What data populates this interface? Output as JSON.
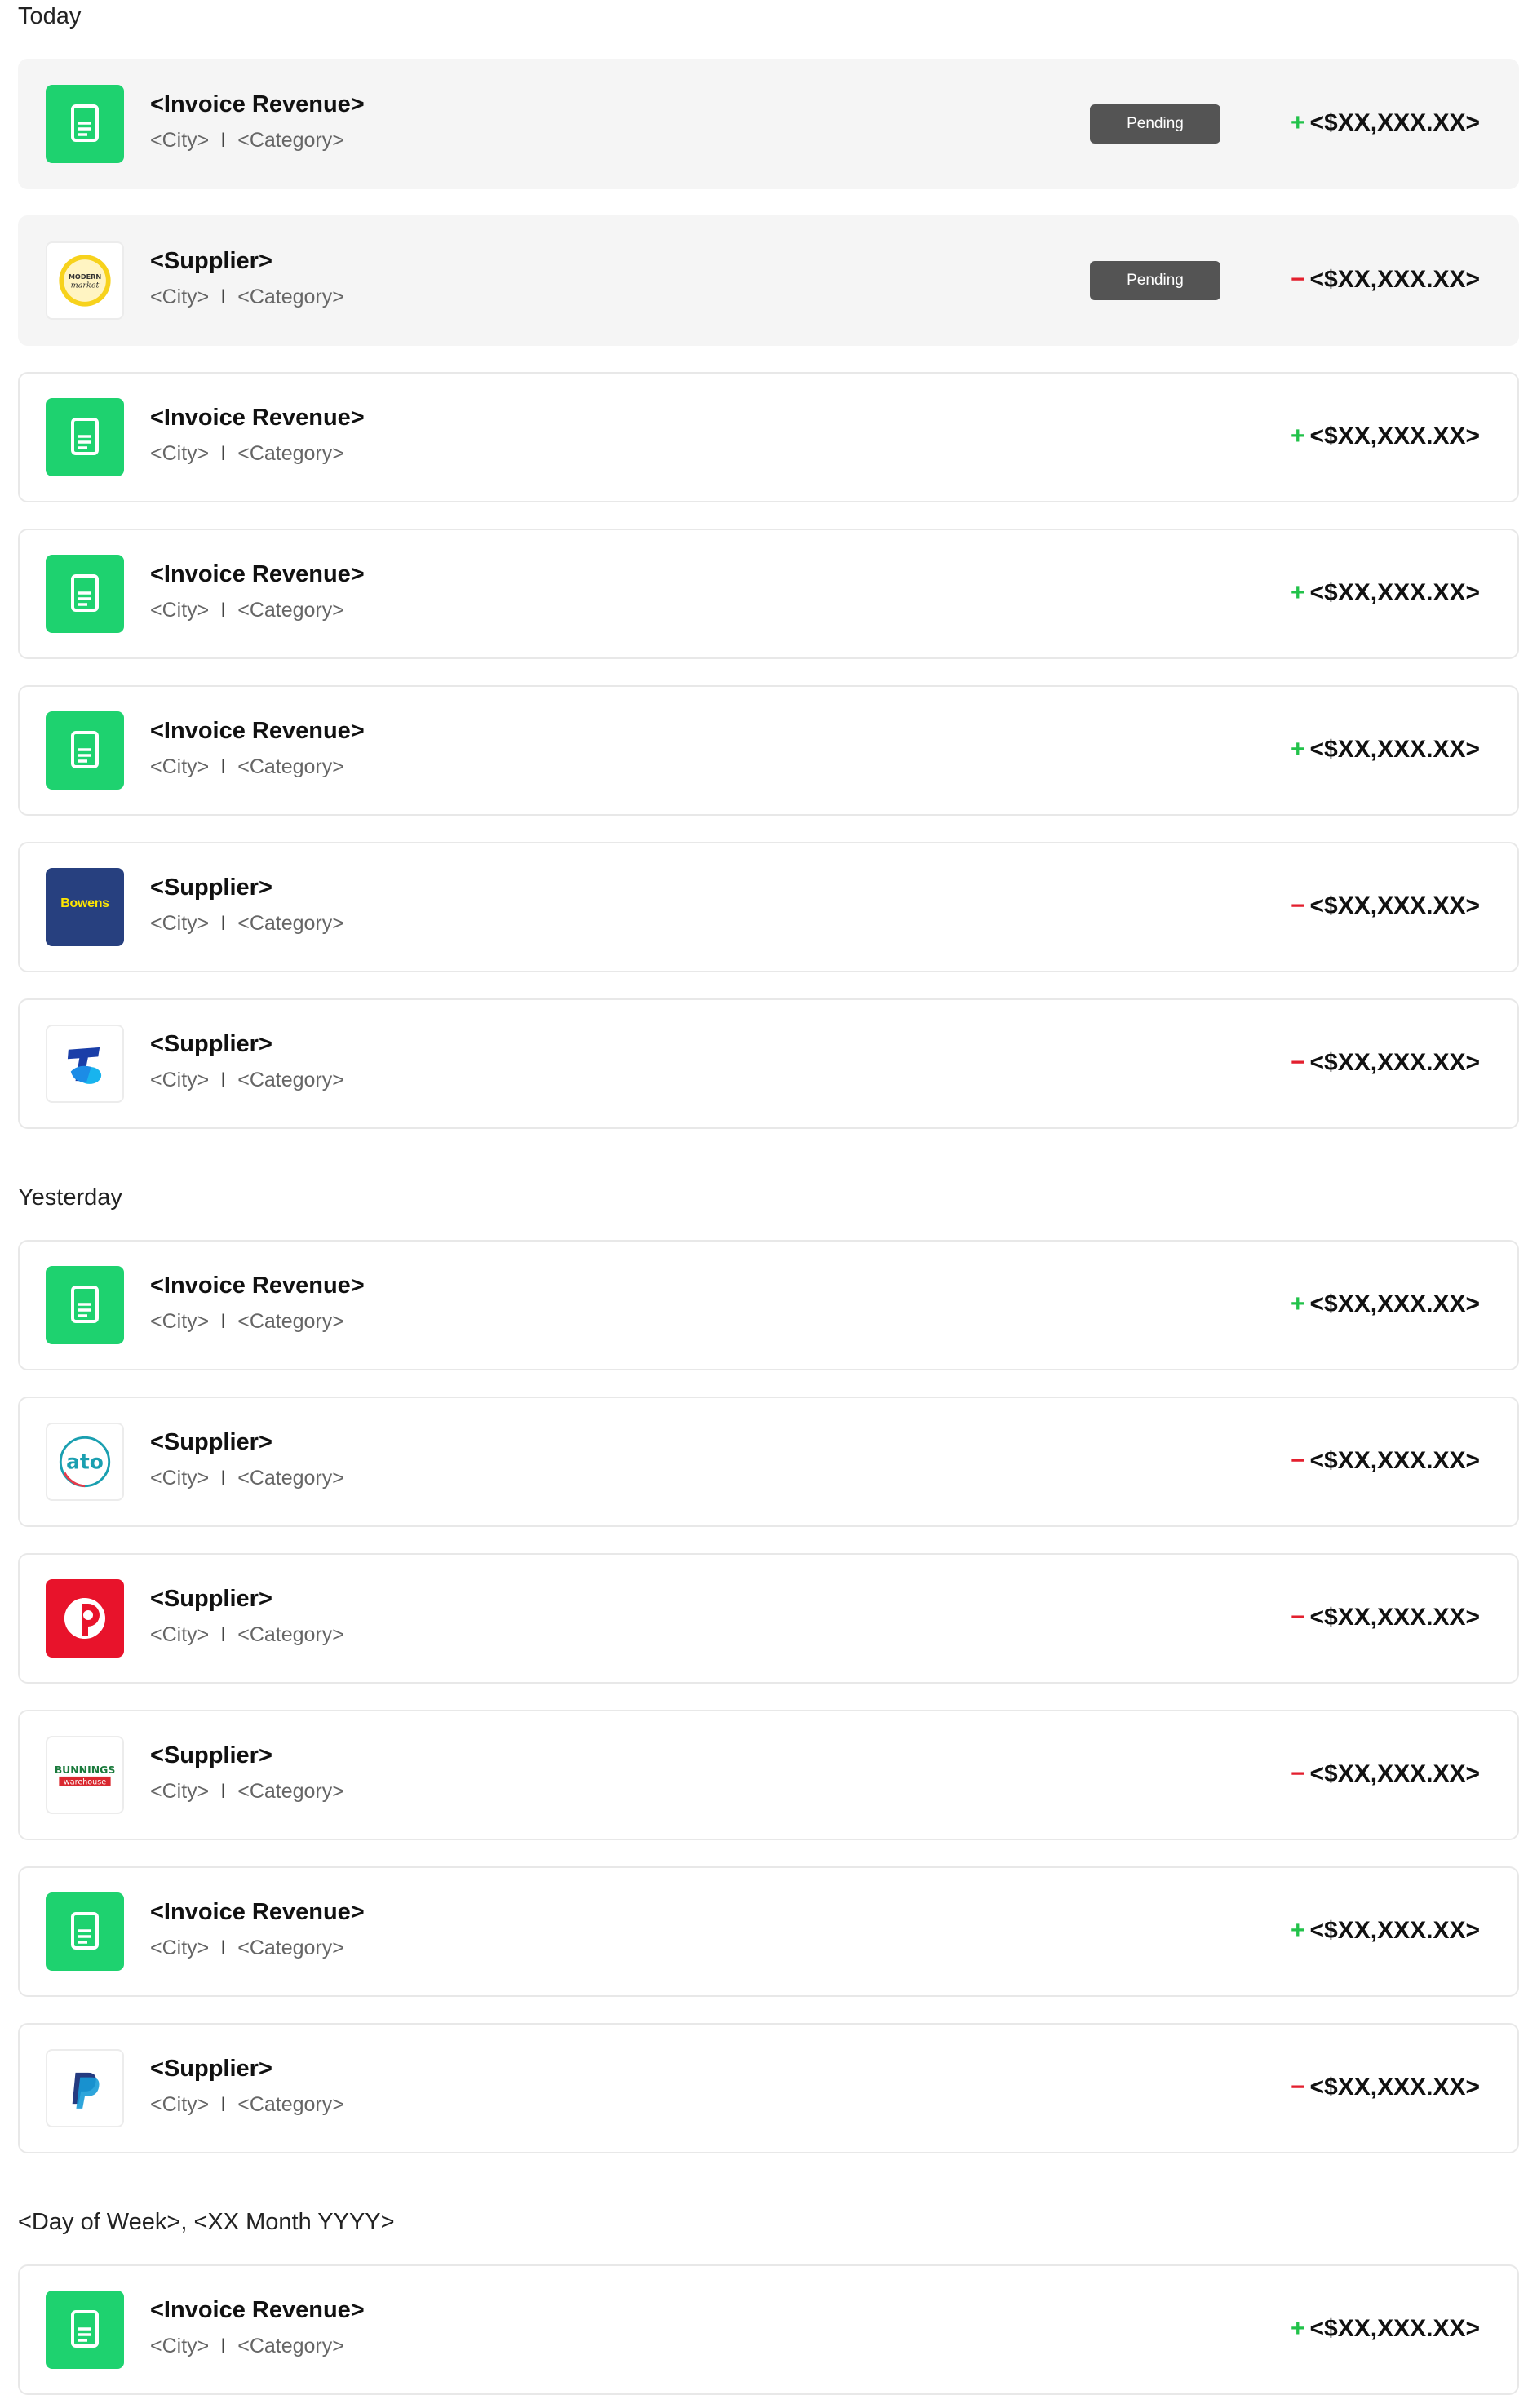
{
  "groups": [
    {
      "title": "Today",
      "rows": [
        {
          "name": "<Invoice Revenue>",
          "city": "<City>",
          "category": "<Category>",
          "status": "Pending",
          "sign": "+",
          "amount": "<$XX,XXX.XX>",
          "icon": "invoice-document-icon"
        },
        {
          "name": "<Supplier>",
          "city": "<City>",
          "category": "<Category>",
          "status": "Pending",
          "sign": "−",
          "amount": "<$XX,XXX.XX>",
          "icon": "modern-market-logo",
          "logo_text": [
            "MODERN",
            "market"
          ]
        },
        {
          "name": "<Invoice Revenue>",
          "city": "<City>",
          "category": "<Category>",
          "sign": "+",
          "amount": "<$XX,XXX.XX>",
          "icon": "invoice-document-icon"
        },
        {
          "name": "<Invoice Revenue>",
          "city": "<City>",
          "category": "<Category>",
          "sign": "+",
          "amount": "<$XX,XXX.XX>",
          "icon": "invoice-document-icon"
        },
        {
          "name": "<Invoice Revenue>",
          "city": "<City>",
          "category": "<Category>",
          "sign": "+",
          "amount": "<$XX,XXX.XX>",
          "icon": "invoice-document-icon"
        },
        {
          "name": "<Supplier>",
          "city": "<City>",
          "category": "<Category>",
          "sign": "−",
          "amount": "<$XX,XXX.XX>",
          "icon": "bowens-logo",
          "logo_text": [
            "Bowens"
          ]
        },
        {
          "name": "<Supplier>",
          "city": "<City>",
          "category": "<Category>",
          "sign": "−",
          "amount": "<$XX,XXX.XX>",
          "icon": "telstra-logo"
        }
      ]
    },
    {
      "title": "Yesterday",
      "rows": [
        {
          "name": "<Invoice Revenue>",
          "city": "<City>",
          "category": "<Category>",
          "sign": "+",
          "amount": "<$XX,XXX.XX>",
          "icon": "invoice-document-icon"
        },
        {
          "name": "<Supplier>",
          "city": "<City>",
          "category": "<Category>",
          "sign": "−",
          "amount": "<$XX,XXX.XX>",
          "icon": "ato-logo",
          "logo_text": [
            "ato"
          ]
        },
        {
          "name": "<Supplier>",
          "city": "<City>",
          "category": "<Category>",
          "sign": "−",
          "amount": "<$XX,XXX.XX>",
          "icon": "australia-post-logo"
        },
        {
          "name": "<Supplier>",
          "city": "<City>",
          "category": "<Category>",
          "sign": "−",
          "amount": "<$XX,XXX.XX>",
          "icon": "bunnings-warehouse-logo",
          "logo_text": [
            "BUNNINGS",
            "warehouse"
          ]
        },
        {
          "name": "<Invoice Revenue>",
          "city": "<City>",
          "category": "<Category>",
          "sign": "+",
          "amount": "<$XX,XXX.XX>",
          "icon": "invoice-document-icon"
        },
        {
          "name": "<Supplier>",
          "city": "<City>",
          "category": "<Category>",
          "sign": "−",
          "amount": "<$XX,XXX.XX>",
          "icon": "paypal-logo"
        }
      ]
    },
    {
      "title": "<Day of Week>, <XX Month YYYY>",
      "rows": [
        {
          "name": "<Invoice Revenue>",
          "city": "<City>",
          "category": "<Category>",
          "sign": "+",
          "amount": "<$XX,XXX.XX>",
          "icon": "invoice-document-icon"
        }
      ]
    }
  ],
  "separator": "I",
  "colors": {
    "invoice_green": "#1ed26f",
    "plus_green": "#22c24a",
    "minus_red": "#e3202e",
    "pending_badge": "#545454",
    "pending_row_bg": "#f5f5f5",
    "row_border": "#e8e8e8"
  }
}
